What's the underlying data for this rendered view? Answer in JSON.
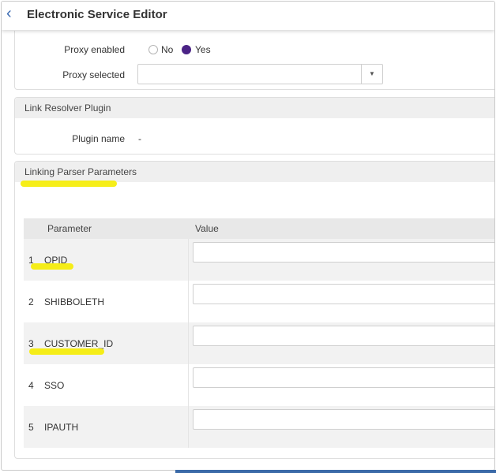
{
  "header": {
    "back_icon": "chevron-left-icon",
    "title": "Electronic Service Editor"
  },
  "proxy": {
    "enabled_label": "Proxy enabled",
    "options": [
      {
        "label": "No",
        "selected": false
      },
      {
        "label": "Yes",
        "selected": true
      }
    ],
    "selected_label": "Proxy selected",
    "selected_value": ""
  },
  "link_resolver": {
    "title": "Link Resolver Plugin",
    "plugin_name_label": "Plugin name",
    "plugin_name_value": "-"
  },
  "linking_parser": {
    "title": "Linking Parser Parameters",
    "columns": {
      "parameter": "Parameter",
      "value": "Value"
    },
    "rows": [
      {
        "num": "1",
        "name": "OPID",
        "value": ""
      },
      {
        "num": "2",
        "name": "SHIBBOLETH",
        "value": ""
      },
      {
        "num": "3",
        "name": "CUSTOMER_ID",
        "value": ""
      },
      {
        "num": "4",
        "name": "SSO",
        "value": ""
      },
      {
        "num": "5",
        "name": "IPAUTH",
        "value": ""
      }
    ]
  },
  "colors": {
    "accent": "#4b2386",
    "link": "#3a6ab2",
    "highlight": "#f5ec00"
  }
}
